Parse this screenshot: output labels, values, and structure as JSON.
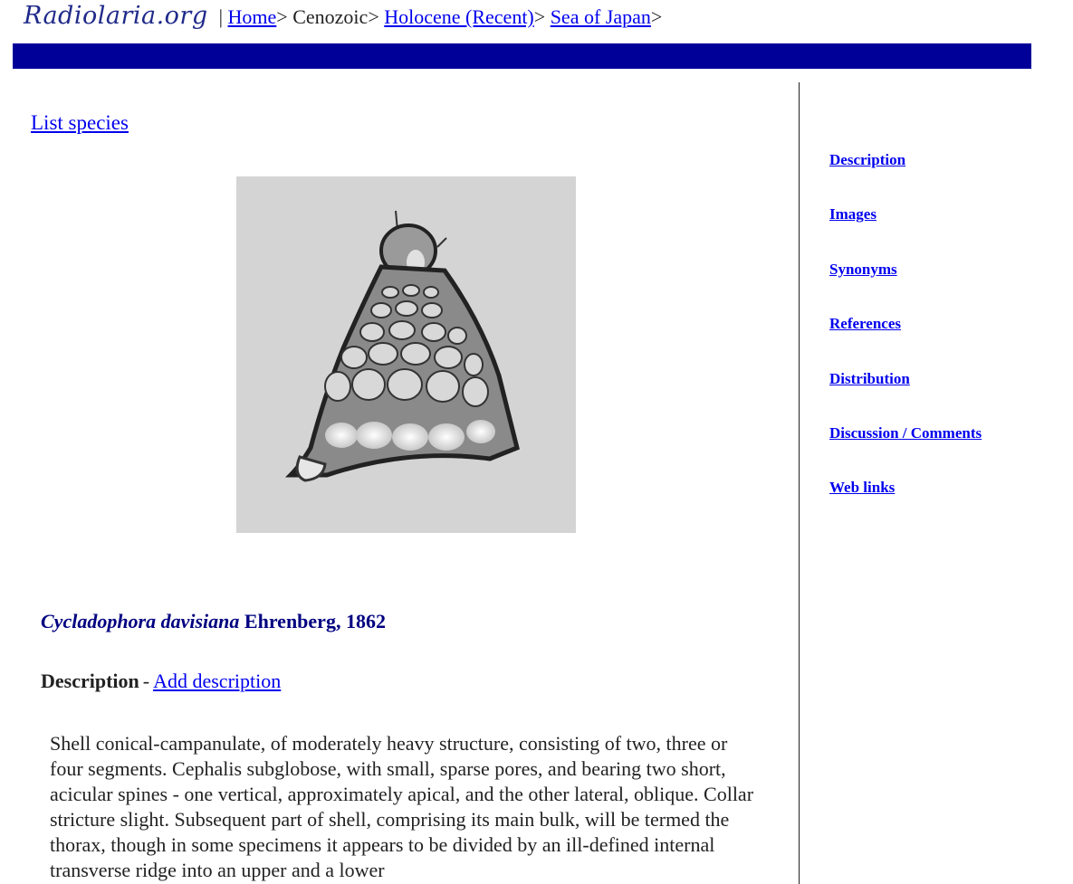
{
  "header": {
    "logo_text": "Radiolaria.org",
    "separator": "|",
    "breadcrumb": {
      "home": "Home",
      "cenozoic": "Cenozoic",
      "holocene": "Holocene (Recent)",
      "sea": "Sea of Japan",
      "arrow": ">"
    }
  },
  "main": {
    "list_species": "List species",
    "image_alt": "Cycladophora davisiana specimen",
    "species": {
      "genus_species": "Cycladophora davisiana",
      "author": "Ehrenberg, 1862"
    },
    "description": {
      "heading": "Description",
      "dash": "-",
      "add_link": "Add description",
      "body": "Shell conical-campanulate, of moderately heavy structure, consisting of two, three or four segments. Cephalis subglobose, with small, sparse pores, and bearing two short, acicular spines - one vertical, approximately apical, and the other lateral, oblique. Collar stricture slight. Subsequent part of shell, comprising its main bulk, will be termed the thorax, though in some specimens it appears to be divided by an ill-defined internal transverse ridge into an upper and a lower"
    }
  },
  "right_nav": {
    "items": [
      {
        "label": "Description"
      },
      {
        "label": "Images"
      },
      {
        "label": "Synonyms"
      },
      {
        "label": "References"
      },
      {
        "label": "Distribution"
      },
      {
        "label": "Discussion / Comments"
      },
      {
        "label": "Web links"
      }
    ]
  },
  "colors": {
    "bar": "#000099",
    "link": "#0000ee",
    "title": "#000080"
  }
}
